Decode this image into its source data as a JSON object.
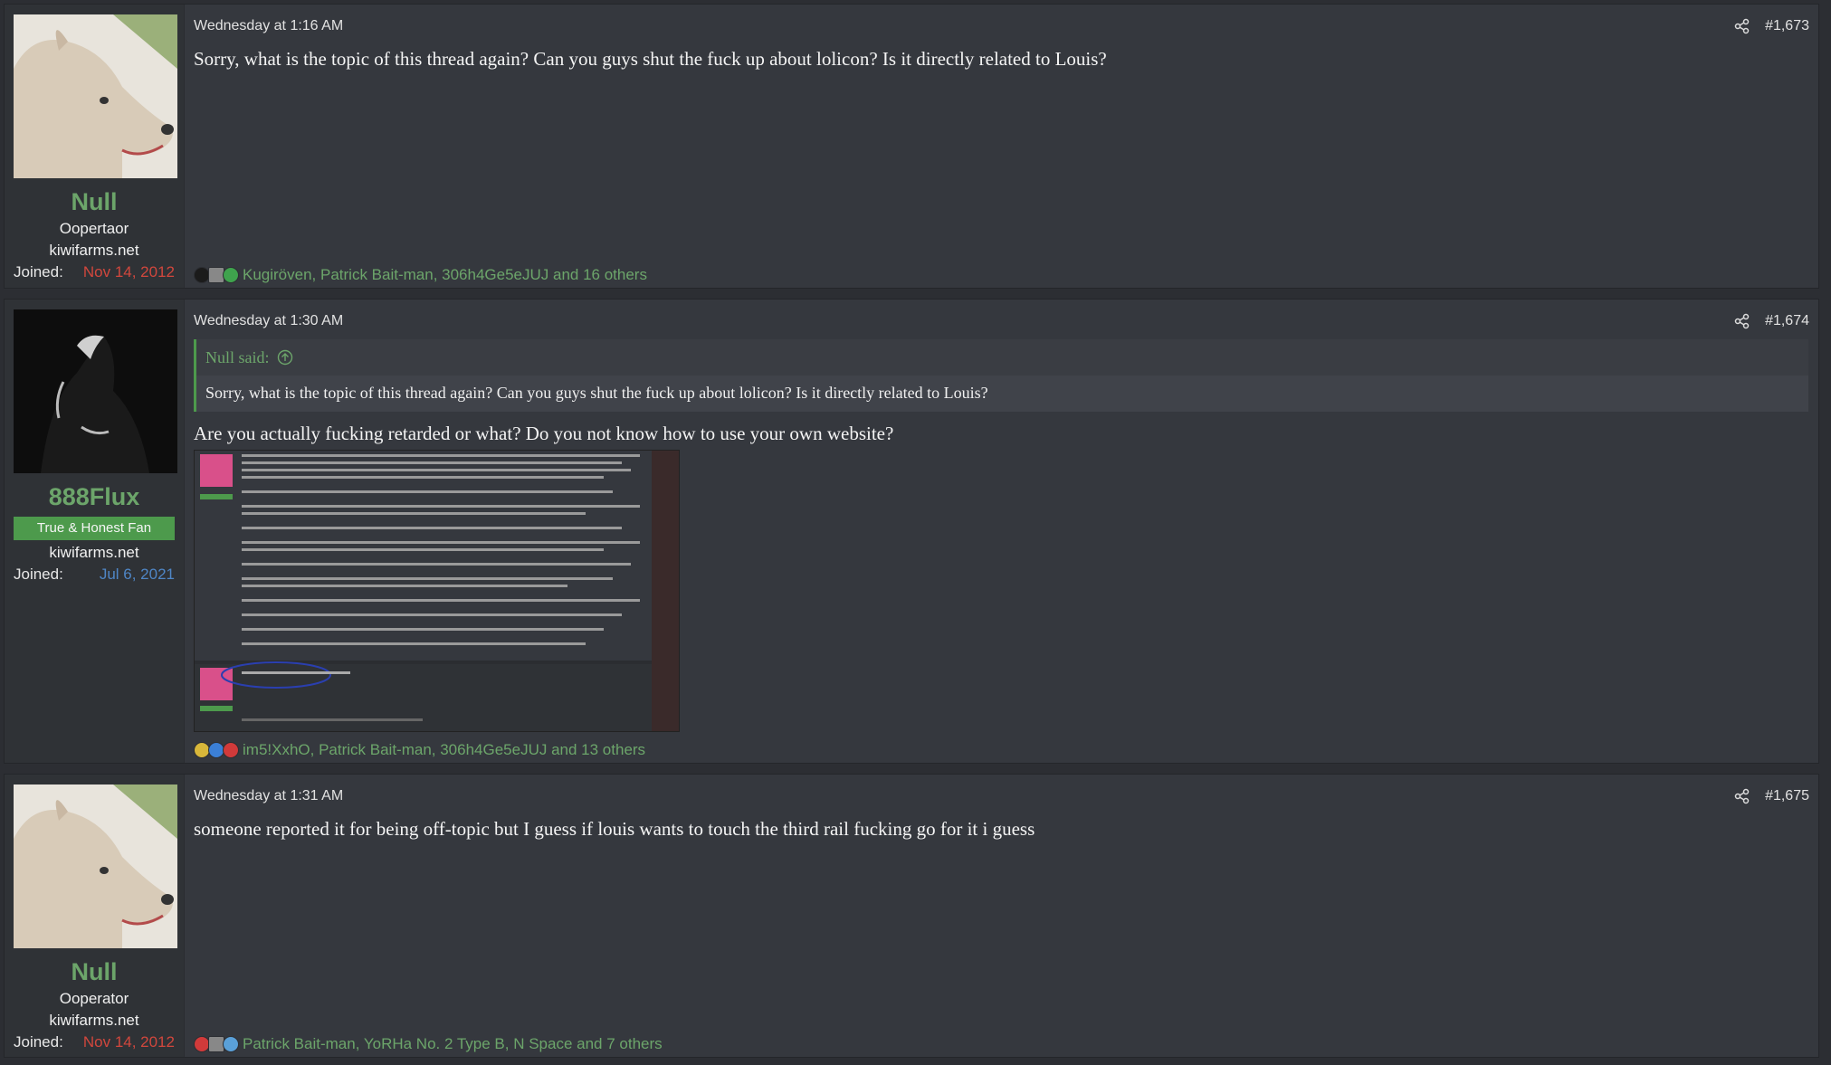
{
  "posts": [
    {
      "user": {
        "name": "Null",
        "title": "Oopertaor",
        "site": "kiwifarms.net",
        "joined_label": "Joined:",
        "joined_date": "Nov 14, 2012"
      },
      "timestamp": "Wednesday at 1:16 AM",
      "number": "#1,673",
      "body": "Sorry, what is the topic of this thread again? Can you guys shut the fuck up about lolicon? Is it directly related to Louis?",
      "reactions": "Kugiröven, Patrick Bait-man, 306h4Ge5eJUJ and 16 others"
    },
    {
      "user": {
        "name": "888Flux",
        "banner": "True & Honest Fan",
        "site": "kiwifarms.net",
        "joined_label": "Joined:",
        "joined_date": "Jul 6, 2021"
      },
      "timestamp": "Wednesday at 1:30 AM",
      "number": "#1,674",
      "quote": {
        "author": "Null said:",
        "text": "Sorry, what is the topic of this thread again? Can you guys shut the fuck up about lolicon? Is it directly related to Louis?"
      },
      "body": "Are you actually fucking retarded or what? Do you not know how to use your own website?",
      "reactions": "im5!XxhO, Patrick Bait-man, 306h4Ge5eJUJ and 13 others"
    },
    {
      "user": {
        "name": "Null",
        "title": "Ooperator",
        "site": "kiwifarms.net",
        "joined_label": "Joined:",
        "joined_date": "Nov 14, 2012"
      },
      "timestamp": "Wednesday at 1:31 AM",
      "number": "#1,675",
      "body": "someone reported it for being off-topic but I guess if louis wants to touch the third rail fucking go for it i guess",
      "reactions": "Patrick Bait-man, YoRHa No. 2 Type B, N Space and 7 others"
    }
  ],
  "colors": {
    "accent": "#6ca56a",
    "background": "#2c2e33",
    "post_bg": "#35383e",
    "joined_red": "#d1473d",
    "joined_blue": "#4f86c6"
  }
}
